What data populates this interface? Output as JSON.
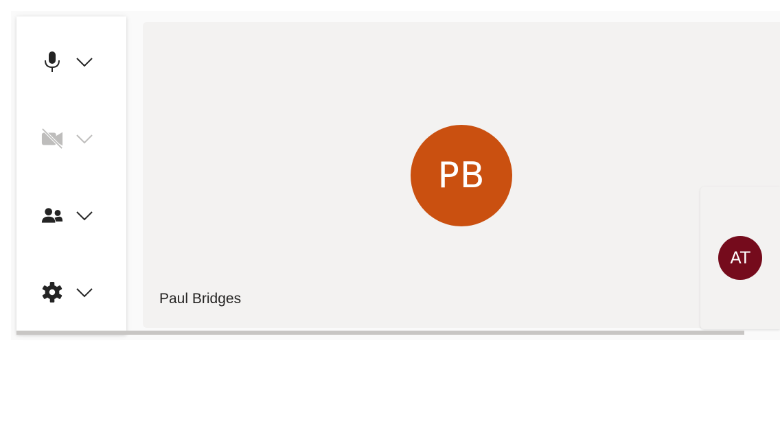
{
  "colors": {
    "frame_bg": "#fafafa",
    "stage_bg": "#f3f2f1",
    "icon": "#242424",
    "icon_disabled": "#8a8886"
  },
  "controls": [
    {
      "id": "microphone",
      "icon": "microphone-icon",
      "disabled": false
    },
    {
      "id": "camera",
      "icon": "camera-off-icon",
      "disabled": true
    },
    {
      "id": "people",
      "icon": "people-icon",
      "disabled": false
    },
    {
      "id": "settings",
      "icon": "gear-icon",
      "disabled": false
    }
  ],
  "main_participant": {
    "initials": "PB",
    "name": "Paul Bridges",
    "avatar_color": "#ca5010"
  },
  "side_participant": {
    "initials": "AT",
    "avatar_color": "#750b1c"
  }
}
